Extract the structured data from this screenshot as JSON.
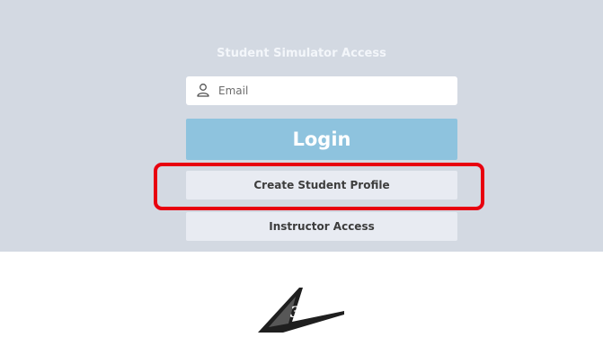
{
  "access": {
    "title": "Student Simulator Access",
    "email_placeholder": "Email",
    "login_label": "Login",
    "create_profile_label": "Create Student Profile",
    "instructor_label": "Instructor Access"
  },
  "brand": {
    "logo_text": "3B"
  },
  "icons": {
    "email": "user-icon",
    "logo": "3b-logo-icon"
  },
  "colors": {
    "panel_background": "#d3d9e2",
    "login_button": "#8ec3de",
    "secondary_button": "#e8ebf2",
    "highlight": "#e8000f"
  }
}
